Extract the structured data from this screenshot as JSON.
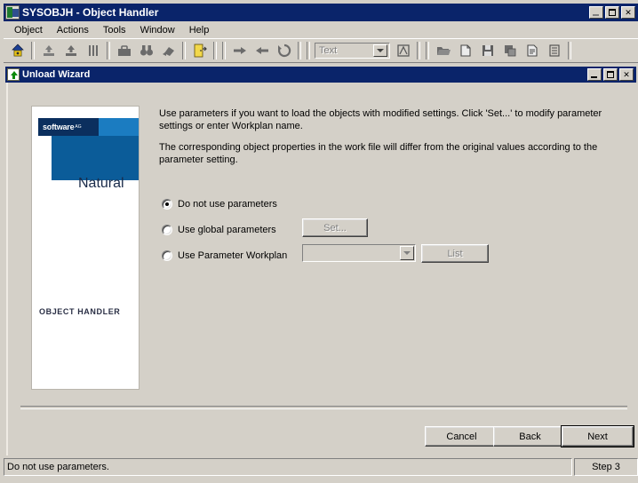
{
  "window": {
    "title": "SYSOBJH - Object Handler",
    "icon": "app-icon",
    "controls": {
      "minimize": "minimize",
      "maximize": "maximize",
      "close": "close"
    }
  },
  "menubar": {
    "items": [
      {
        "label": "Object"
      },
      {
        "label": "Actions"
      },
      {
        "label": "Tools"
      },
      {
        "label": "Window"
      },
      {
        "label": "Help"
      }
    ]
  },
  "toolbar": {
    "buttons": [
      {
        "name": "home-icon",
        "glyph": "home"
      },
      {
        "name": "unload-icon",
        "glyph": "unload"
      },
      {
        "name": "load-icon",
        "glyph": "load"
      },
      {
        "name": "scan-icon",
        "glyph": "scan"
      },
      {
        "name": "find-objects-icon",
        "glyph": "briefcase"
      },
      {
        "name": "find-icon",
        "glyph": "binoculars"
      },
      {
        "name": "delete-icon",
        "glyph": "eraser"
      },
      {
        "name": "exit-icon",
        "glyph": "door"
      },
      {
        "name": "forward-icon",
        "glyph": "arrow-right"
      },
      {
        "name": "back-icon",
        "glyph": "arrow-left"
      },
      {
        "name": "refresh-icon",
        "glyph": "refresh"
      }
    ],
    "combo": {
      "value": "Text",
      "arrow": "chevron-down-icon"
    },
    "buttons_right": [
      {
        "name": "report-icon",
        "glyph": "report"
      },
      {
        "name": "open-icon",
        "glyph": "open-folder"
      },
      {
        "name": "new-file-icon",
        "glyph": "new-file"
      },
      {
        "name": "save-icon",
        "glyph": "save"
      },
      {
        "name": "copy-icon",
        "glyph": "copy"
      },
      {
        "name": "edit-list-icon",
        "glyph": "edit-list"
      },
      {
        "name": "properties-icon",
        "glyph": "properties"
      }
    ]
  },
  "dialog": {
    "title": "Unload Wizard",
    "icon": "unload-wizard-icon",
    "controls": {
      "minimize": "minimize",
      "maximize": "maximize",
      "close": "close"
    },
    "logo": {
      "brand": "software",
      "brand_suffix": "AG",
      "product": "Natural",
      "application": "OBJECT HANDLER"
    },
    "paragraphs": [
      "Use parameters if you want to load the objects with modified settings. Click 'Set...' to modify parameter settings or enter Workplan name.",
      "The corresponding object properties in the work file will differ from the original values according to the parameter setting."
    ],
    "options": [
      {
        "label": "Do not use parameters",
        "selected": true
      },
      {
        "label": "Use global parameters",
        "selected": false
      },
      {
        "label": "Use Parameter Workplan",
        "selected": false
      }
    ],
    "set_button": {
      "label": "Set...",
      "enabled": false
    },
    "list_button": {
      "label": "List",
      "enabled": false
    },
    "workplan_combo": {
      "value": "",
      "enabled": false
    },
    "footer": {
      "cancel": "Cancel",
      "back": "Back",
      "next": "Next"
    }
  },
  "statusbar": {
    "message": "Do not use parameters.",
    "step": "Step 3"
  },
  "colors": {
    "titlebar": "#0a246a",
    "face": "#d4d0c8",
    "brand_dark": "#0b2f5e",
    "brand_blue": "#0b5c99",
    "brand_light": "#1b7cc1"
  }
}
